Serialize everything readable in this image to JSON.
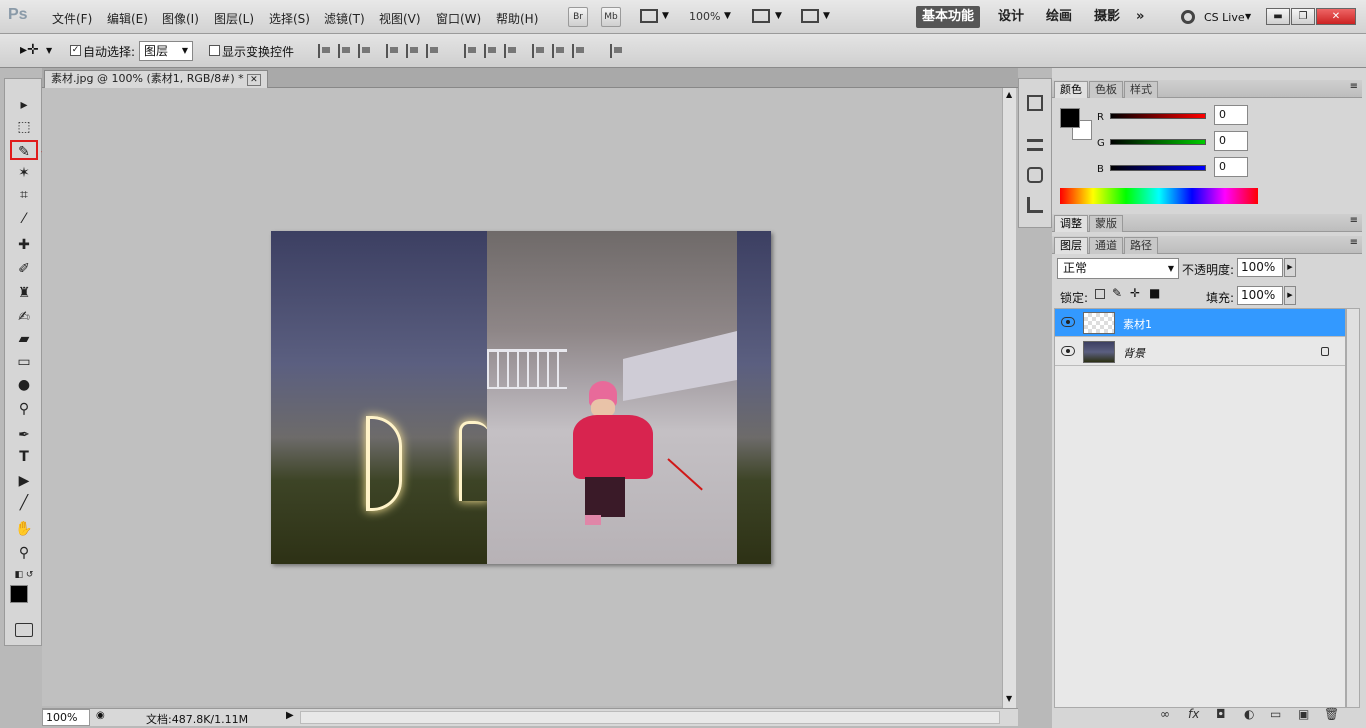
{
  "app": {
    "logo": "Ps"
  },
  "menu": [
    "文件(F)",
    "编辑(E)",
    "图像(I)",
    "图层(L)",
    "选择(S)",
    "滤镜(T)",
    "视图(V)",
    "窗口(W)",
    "帮助(H)"
  ],
  "appbar": {
    "bridge": "Br",
    "minibridge": "Mb",
    "zoom": "100%"
  },
  "workspaces": {
    "active": "基本功能",
    "items": [
      "设计",
      "绘画",
      "摄影"
    ],
    "more": "»"
  },
  "cslive": "CS Live",
  "options": {
    "auto_select_label": "自动选择:",
    "auto_select_value": "图层",
    "show_transform_label": "显示变换控件"
  },
  "document": {
    "tab_title": "素材.jpg @ 100% (素材1, RGB/8#) *"
  },
  "status": {
    "zoom": "100%",
    "doc_info": "文档:487.8K/1.11M"
  },
  "color_panel": {
    "tabs": [
      "颜色",
      "色板",
      "样式"
    ],
    "channels": [
      {
        "label": "R",
        "value": "0"
      },
      {
        "label": "G",
        "value": "0"
      },
      {
        "label": "B",
        "value": "0"
      }
    ]
  },
  "adjust_panel": {
    "tabs": [
      "调整",
      "蒙版"
    ]
  },
  "layers_panel": {
    "tabs": [
      "图层",
      "通道",
      "路径"
    ],
    "blend_mode": "正常",
    "opacity_label": "不透明度:",
    "opacity": "100%",
    "lock_label": "锁定:",
    "fill_label": "填充:",
    "fill": "100%",
    "layers": [
      {
        "name": "素材1",
        "selected": true
      },
      {
        "name": "背景",
        "selected": false
      }
    ]
  },
  "colors": {
    "selection": "#3399ff",
    "highlight_box": "#e01b1b"
  }
}
